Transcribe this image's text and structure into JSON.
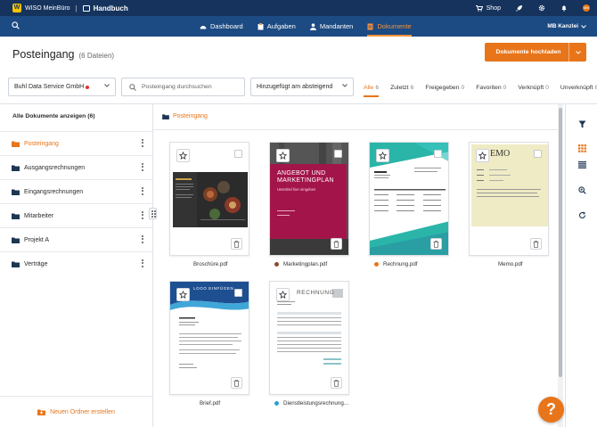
{
  "topbar": {
    "app_name": "WISO MeinBüro",
    "separator": "|",
    "book_label": "Handbuch",
    "shop_label": "Shop",
    "avatar_initials": "MB"
  },
  "nav": {
    "items": [
      {
        "label": "Dashboard",
        "icon": "dashboard-icon"
      },
      {
        "label": "Aufgaben",
        "icon": "tasks-icon"
      },
      {
        "label": "Mandanten",
        "icon": "user-icon"
      },
      {
        "label": "Dokumente",
        "icon": "documents-icon"
      }
    ],
    "active": "Dokumente",
    "company": "MB Kanzlei"
  },
  "page": {
    "title": "Posteingang",
    "count": "(6 Dateien)",
    "upload_button": "Dokumente hochladen"
  },
  "filters": {
    "company_select": "Buhl Data Service GmbH",
    "search_placeholder": "Posteingang durchsuchen",
    "sort_select": "Hinzugefügt am absteigend",
    "tabs": [
      {
        "label": "Alle",
        "count": "6"
      },
      {
        "label": "Zuletzt",
        "count": "6"
      },
      {
        "label": "Freigegeben",
        "count": "0"
      },
      {
        "label": "Favoriten",
        "count": "0"
      },
      {
        "label": "Verknüpft",
        "count": "0"
      },
      {
        "label": "Unverknüpft",
        "count": "6"
      }
    ]
  },
  "sidebar": {
    "header": "Alle Dokumente anzeigen (6)",
    "folders": [
      {
        "label": "Posteingang"
      },
      {
        "label": "Ausgangsrechnungen"
      },
      {
        "label": "Eingangsrechnungen"
      },
      {
        "label": "Mitarbeiter"
      },
      {
        "label": "Projekt A"
      },
      {
        "label": "Verträge"
      }
    ],
    "new_folder": "Neuen Ordner erstellen"
  },
  "main": {
    "breadcrumb": "Posteingang"
  },
  "documents": [
    {
      "name": "Broschüre.pdf",
      "color": ""
    },
    {
      "name": "Marketingplan.pdf",
      "color": "#8a4a2e",
      "thumb_title": "ANGEBOT UND MARKETINGPLAN",
      "thumb_sub": "Untertitel hier eingeben"
    },
    {
      "name": "Rechnung.pdf",
      "color": "#e8751a"
    },
    {
      "name": "Memo.pdf",
      "color": "",
      "thumb_title": "EMO"
    },
    {
      "name": "Brief.pdf",
      "color": "",
      "thumb_title": "LOGO EINFÜGEN"
    },
    {
      "name": "Dienstleistungsrechnung...",
      "color": "#2a9fd8",
      "thumb_title": "RECHNUNG"
    }
  ],
  "help": {
    "label": "?"
  },
  "colors": {
    "navy": "#15335c",
    "nav_blue": "#1c4a82",
    "accent": "#e8751a"
  }
}
